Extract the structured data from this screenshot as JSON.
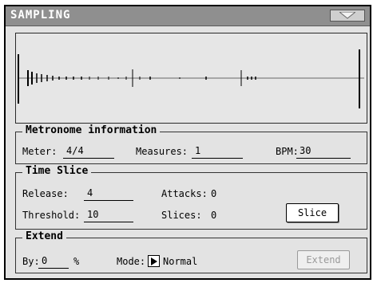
{
  "window": {
    "title": "SAMPLING",
    "menu_icon": "triangle-down-icon"
  },
  "metronome": {
    "title": "Metronome information",
    "meter_label": "Meter:",
    "meter_value": "4/4",
    "measures_label": "Measures:",
    "measures_value": "1",
    "bpm_label": "BPM:",
    "bpm_value": "30"
  },
  "time_slice": {
    "title": "Time Slice",
    "release_label": "Release:",
    "release_value": "4",
    "threshold_label": "Threshold:",
    "threshold_value": "10",
    "attacks_label": "Attacks:",
    "attacks_value": "0",
    "slices_label": "Slices:",
    "slices_value": "0",
    "slice_button": "Slice"
  },
  "extend": {
    "title": "Extend",
    "by_label": "By:",
    "by_value": "0",
    "by_unit": "%",
    "mode_label": "Mode:",
    "mode_value": "Normal",
    "extend_button": "Extend"
  },
  "colors": {
    "titlebar": "#8f8f8f",
    "panel": "#e3e3e3",
    "disabled_text": "#9a9a9a"
  }
}
